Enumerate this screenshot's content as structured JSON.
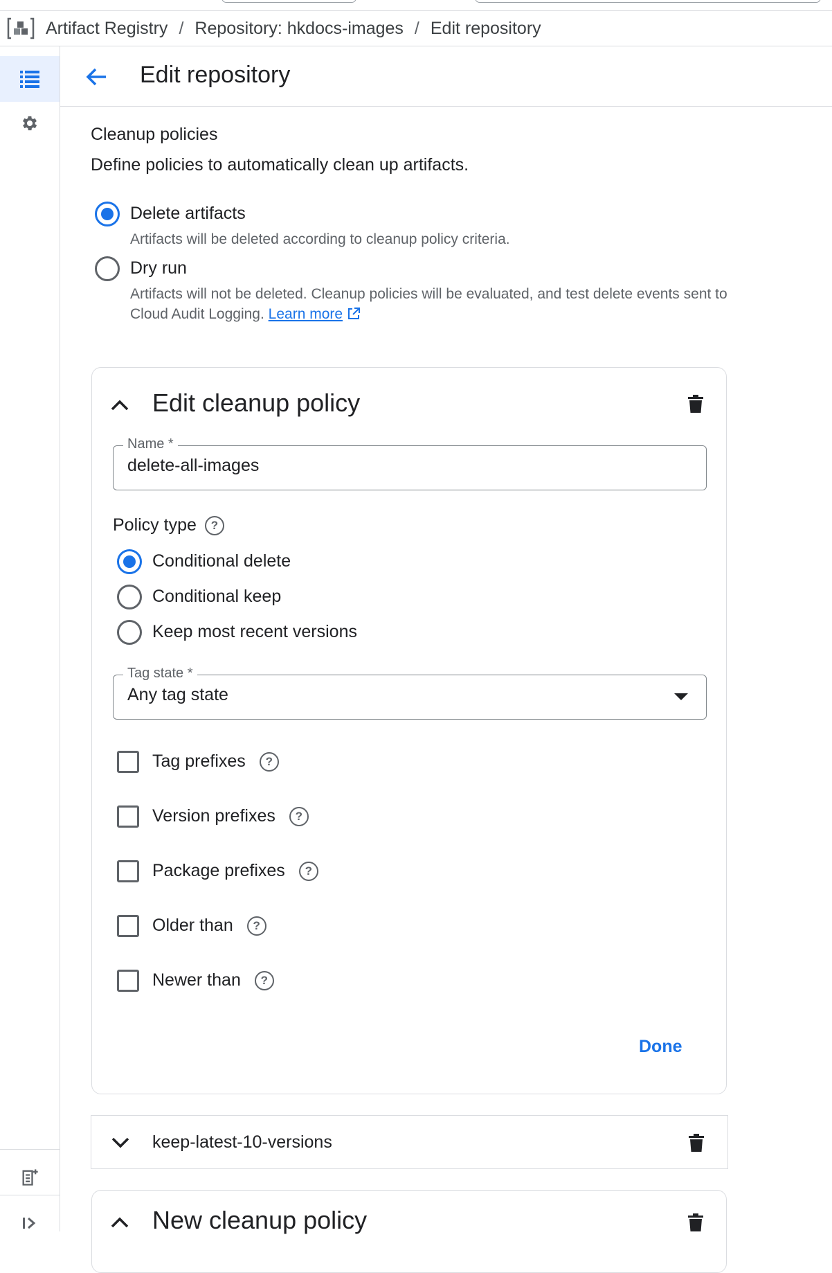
{
  "breadcrumb": {
    "items": [
      "Artifact Registry",
      "Repository: hkdocs-images",
      "Edit repository"
    ],
    "separator": "/"
  },
  "header": {
    "title": "Edit repository"
  },
  "cleanup": {
    "title": "Cleanup policies",
    "description": "Define policies to automatically clean up artifacts.",
    "mode_options": [
      {
        "label": "Delete artifacts",
        "help": "Artifacts will be deleted according to cleanup policy criteria.",
        "checked": true
      },
      {
        "label": "Dry run",
        "help": "Artifacts will not be deleted. Cleanup policies will be evaluated, and test delete events sent to Cloud Audit Logging.",
        "checked": false
      }
    ],
    "learn_more": "Learn more"
  },
  "policy_card": {
    "title": "Edit cleanup policy",
    "name_label": "Name *",
    "name_value": "delete-all-images",
    "policy_type_label": "Policy type",
    "policy_types": [
      {
        "label": "Conditional delete",
        "checked": true
      },
      {
        "label": "Conditional keep",
        "checked": false
      },
      {
        "label": "Keep most recent versions",
        "checked": false
      }
    ],
    "tag_state_label": "Tag state *",
    "tag_state_value": "Any tag state",
    "conditions": [
      "Tag prefixes",
      "Version prefixes",
      "Package prefixes",
      "Older than",
      "Newer than"
    ],
    "done_label": "Done"
  },
  "collapsed_policy": {
    "label": "keep-latest-10-versions"
  },
  "new_policy": {
    "title": "New cleanup policy"
  },
  "colors": {
    "accent": "#1a73e8",
    "border": "#dadce0",
    "text": "#202124",
    "muted": "#5f6368"
  }
}
